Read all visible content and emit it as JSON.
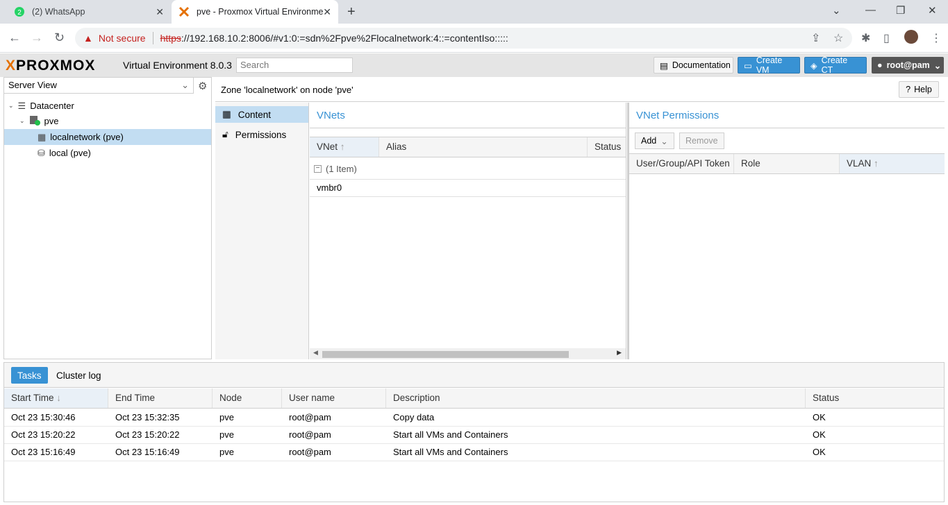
{
  "browser": {
    "tabs": [
      {
        "title": "(2) WhatsApp",
        "badge": "2"
      },
      {
        "title": "pve - Proxmox Virtual Environme"
      }
    ],
    "not_secure": "Not secure",
    "url_scheme": "https",
    "url_rest": "://192.168.10.2:8006/#v1:0:=sdn%2Fpve%2Flocalnetwork:4::=contentIso:::::"
  },
  "header": {
    "logo": "PROXMOX",
    "version": "Virtual Environment 8.0.3",
    "search_placeholder": "Search",
    "documentation": "Documentation",
    "create_vm": "Create VM",
    "create_ct": "Create CT",
    "user": "root@pam"
  },
  "tree": {
    "view": "Server View",
    "items": [
      {
        "label": "Datacenter"
      },
      {
        "label": "pve"
      },
      {
        "label": "localnetwork (pve)"
      },
      {
        "label": "local (pve)"
      }
    ]
  },
  "content": {
    "title": "Zone 'localnetwork' on node 'pve'",
    "help": "Help",
    "subnav": [
      {
        "label": "Content"
      },
      {
        "label": "Permissions"
      }
    ],
    "vnets": {
      "title": "VNets",
      "columns": [
        "VNet",
        "Alias",
        "Status"
      ],
      "group": "(1 Item)",
      "rows": [
        {
          "vnet": "vmbr0"
        }
      ]
    },
    "perms": {
      "title": "VNet Permissions",
      "add": "Add",
      "remove": "Remove",
      "columns": [
        "User/Group/API Token",
        "Role",
        "VLAN"
      ]
    }
  },
  "tasks": {
    "tabs": [
      "Tasks",
      "Cluster log"
    ],
    "columns": [
      "Start Time",
      "End Time",
      "Node",
      "User name",
      "Description",
      "Status"
    ],
    "rows": [
      {
        "start": "Oct 23 15:30:46",
        "end": "Oct 23 15:32:35",
        "node": "pve",
        "user": "root@pam",
        "desc": "Copy data",
        "status": "OK"
      },
      {
        "start": "Oct 23 15:20:22",
        "end": "Oct 23 15:20:22",
        "node": "pve",
        "user": "root@pam",
        "desc": "Start all VMs and Containers",
        "status": "OK"
      },
      {
        "start": "Oct 23 15:16:49",
        "end": "Oct 23 15:16:49",
        "node": "pve",
        "user": "root@pam",
        "desc": "Start all VMs and Containers",
        "status": "OK"
      }
    ]
  }
}
